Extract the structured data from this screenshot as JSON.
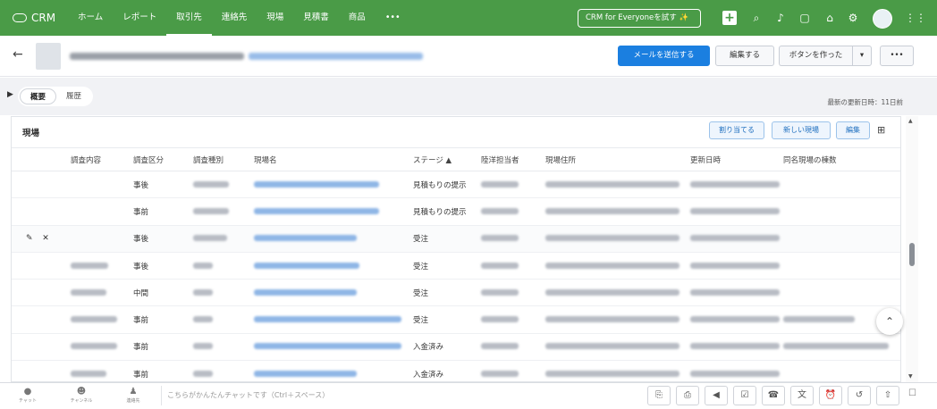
{
  "app": {
    "logo_text": "CRM"
  },
  "nav": {
    "items": [
      "ホーム",
      "レポート",
      "取引先",
      "連絡先",
      "現場",
      "見積書",
      "商品",
      "•••"
    ],
    "active_index": 2
  },
  "topbar": {
    "cta_label": "CRM for Everyoneを試す ✨",
    "icons": [
      "plus-icon",
      "search-icon",
      "bell-icon",
      "calendar-icon",
      "store-icon",
      "gear-icon",
      "avatar",
      "apps-grid-icon"
    ]
  },
  "header": {
    "send_mail_label": "メールを送信する",
    "edit_label": "編集する",
    "create_button_label": "ボタンを作った",
    "more_label": "•••"
  },
  "subbar": {
    "tabs": [
      "概要",
      "履歴"
    ],
    "active_tab": 0,
    "updated_text": "最新の更新日時：11日前"
  },
  "panel": {
    "title": "現場",
    "buttons": {
      "assign": "割り当てる",
      "new_site": "新しい現場",
      "edit": "編集"
    },
    "columns": [
      "",
      "調査内容",
      "調査区分",
      "調査種別",
      "現場名",
      "ステージ ▲",
      "陸洋担当者",
      "現場住所",
      "更新日時",
      "同名現場の棟数"
    ],
    "rows": [
      {
        "category": "事後",
        "stage": "見積もりの提示"
      },
      {
        "category": "事前",
        "stage": "見積もりの提示"
      },
      {
        "category": "事後",
        "stage": "受注"
      },
      {
        "category": "事後",
        "stage": "受注"
      },
      {
        "category": "中間",
        "stage": "受注"
      },
      {
        "category": "事前",
        "stage": "受注"
      },
      {
        "category": "事前",
        "stage": "入金済み"
      },
      {
        "category": "事前",
        "stage": "入金済み"
      }
    ]
  },
  "bottombar": {
    "items": [
      "チャット",
      "チャンネル",
      "連絡先"
    ],
    "chat_placeholder": "こちらがかんたんチャットです（Ctrl＋スペース）"
  }
}
